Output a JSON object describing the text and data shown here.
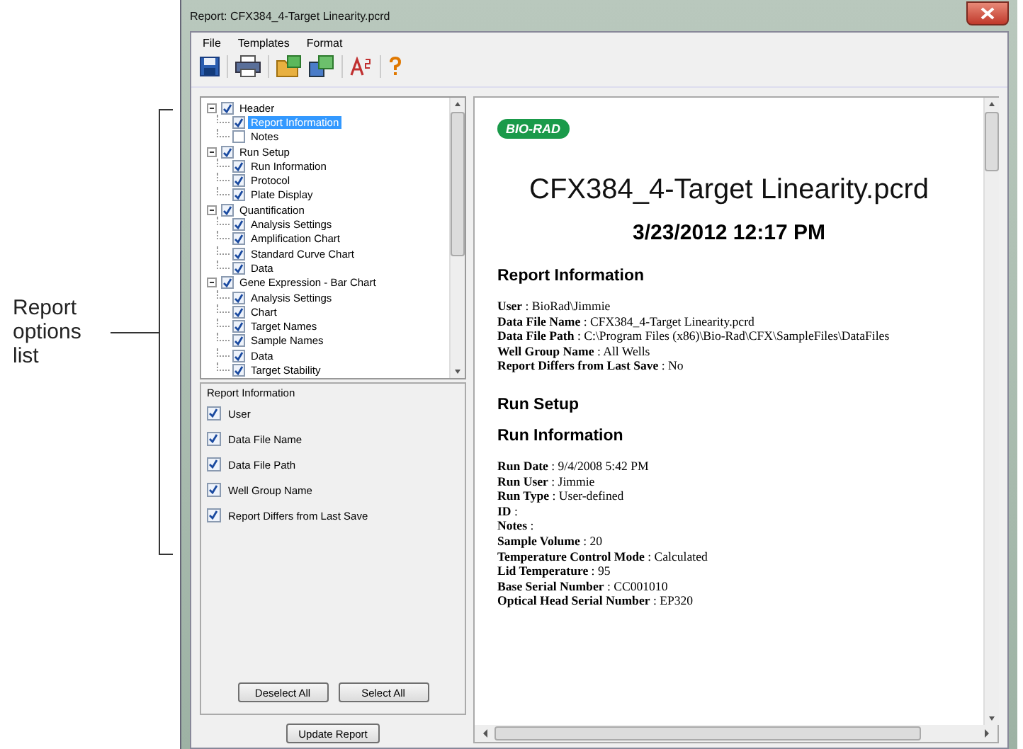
{
  "callout": {
    "label": "Report options list"
  },
  "window": {
    "title": "Report: CFX384_4-Target Linearity.pcrd"
  },
  "menu": [
    "File",
    "Templates",
    "Format"
  ],
  "toolbar": [
    {
      "kind": "save"
    },
    {
      "kind": "print"
    },
    {
      "kind": "export"
    },
    {
      "kind": "import"
    },
    {
      "kind": "font"
    },
    {
      "kind": "help"
    }
  ],
  "tree": [
    {
      "label": "Header",
      "checked": true,
      "selected": false,
      "expanded": true,
      "children": [
        {
          "label": "Report Information",
          "checked": true,
          "selected": true
        },
        {
          "label": "Notes",
          "checked": false,
          "selected": false
        }
      ]
    },
    {
      "label": "Run Setup",
      "checked": true,
      "selected": false,
      "expanded": true,
      "children": [
        {
          "label": "Run Information",
          "checked": true,
          "selected": false
        },
        {
          "label": "Protocol",
          "checked": true,
          "selected": false
        },
        {
          "label": "Plate Display",
          "checked": true,
          "selected": false
        }
      ]
    },
    {
      "label": "Quantification",
      "checked": true,
      "selected": false,
      "expanded": true,
      "children": [
        {
          "label": "Analysis Settings",
          "checked": true,
          "selected": false
        },
        {
          "label": "Amplification Chart",
          "checked": true,
          "selected": false
        },
        {
          "label": "Standard Curve Chart",
          "checked": true,
          "selected": false
        },
        {
          "label": "Data",
          "checked": true,
          "selected": false
        }
      ]
    },
    {
      "label": "Gene Expression - Bar Chart",
      "checked": true,
      "selected": false,
      "expanded": true,
      "children": [
        {
          "label": "Analysis Settings",
          "checked": true,
          "selected": false
        },
        {
          "label": "Chart",
          "checked": true,
          "selected": false
        },
        {
          "label": "Target Names",
          "checked": true,
          "selected": false
        },
        {
          "label": "Sample Names",
          "checked": true,
          "selected": false
        },
        {
          "label": "Data",
          "checked": true,
          "selected": false
        },
        {
          "label": "Target Stability",
          "checked": true,
          "selected": false
        }
      ]
    }
  ],
  "options": {
    "title": "Report Information",
    "items": [
      {
        "label": "User",
        "checked": true
      },
      {
        "label": "Data File Name",
        "checked": true
      },
      {
        "label": "Data File Path",
        "checked": true
      },
      {
        "label": "Well Group Name",
        "checked": true
      },
      {
        "label": "Report Differs from Last Save",
        "checked": true
      }
    ],
    "buttons": [
      "Deselect All",
      "Select All"
    ]
  },
  "update_button": "Update Report",
  "report": [
    {
      "kind": "logo",
      "text": "BIO-RAD"
    },
    {
      "kind": "title",
      "text": "CFX384_4-Target Linearity.pcrd"
    },
    {
      "kind": "date",
      "text": "3/23/2012 12:17 PM"
    },
    {
      "kind": "section",
      "text": "Report Information"
    },
    {
      "kind": "field",
      "text": "**User** : BioRad\\Jimmie"
    },
    {
      "kind": "field",
      "text": "**Data File Name** : CFX384_4-Target Linearity.pcrd"
    },
    {
      "kind": "field",
      "text": "**Data File Path** : C:\\Program Files (x86)\\Bio-Rad\\CFX\\SampleFiles\\DataFiles"
    },
    {
      "kind": "field",
      "text": "**Well Group Name** : All Wells"
    },
    {
      "kind": "field",
      "text": "**Report Differs from Last Save** : No"
    },
    {
      "kind": "section",
      "text": "Run Setup"
    },
    {
      "kind": "subsection",
      "text": "Run Information"
    },
    {
      "kind": "field",
      "text": "**Run Date** : 9/4/2008 5:42 PM"
    },
    {
      "kind": "field",
      "text": "**Run User** : Jimmie"
    },
    {
      "kind": "field",
      "text": "**Run Type** : User-defined"
    },
    {
      "kind": "field",
      "text": "**ID** :"
    },
    {
      "kind": "field",
      "text": "**Notes** :"
    },
    {
      "kind": "field",
      "text": "**Sample Volume** : 20"
    },
    {
      "kind": "field",
      "text": "**Temperature Control Mode** : Calculated"
    },
    {
      "kind": "field",
      "text": "**Lid Temperature** : 95"
    },
    {
      "kind": "field",
      "text": "**Base Serial Number** : CC001010"
    },
    {
      "kind": "field",
      "text": "**Optical Head Serial Number** : EP320"
    }
  ]
}
